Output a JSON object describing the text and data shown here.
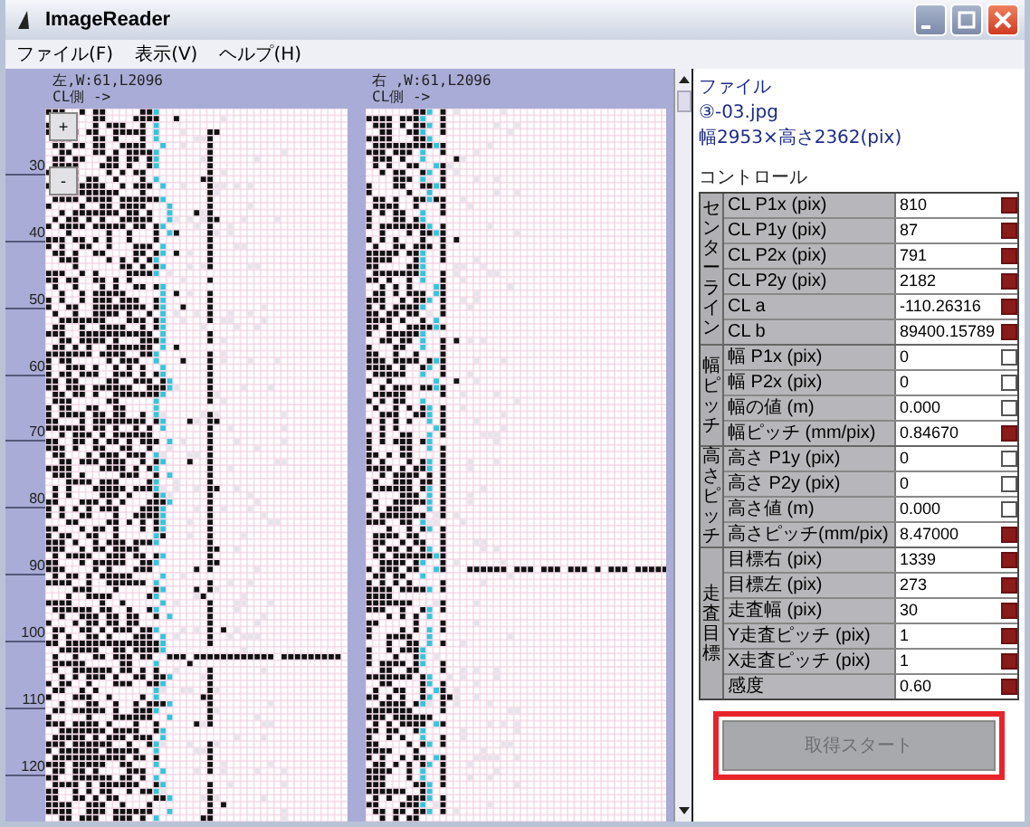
{
  "window": {
    "title": "ImageReader"
  },
  "menu": [
    "ファイル(F)",
    "表示(V)",
    "ヘルプ(H)"
  ],
  "views": [
    {
      "caption_1": "左,W:61,L2096",
      "caption_2": "CL側 ->"
    },
    {
      "caption_1": "右 ,W:61,L2096",
      "caption_2": "CL側 ->"
    }
  ],
  "zoom_buttons": [
    "+",
    "-"
  ],
  "ruler_labels": [
    "30",
    "40",
    "50",
    "60",
    "70",
    "80",
    "90",
    "100",
    "110",
    "120"
  ],
  "info": {
    "heading": "ファイル",
    "file_name": "③-03.jpg",
    "dimensions": "幅2953×高さ2362(pix)"
  },
  "controls": {
    "heading": "コントロール",
    "groups": [
      {
        "label": "センターライン",
        "rows": [
          {
            "label": "CL P1x (pix)",
            "value": "810",
            "set": true
          },
          {
            "label": "CL P1y (pix)",
            "value": "87",
            "set": true
          },
          {
            "label": "CL P2x (pix)",
            "value": "791",
            "set": true
          },
          {
            "label": "CL P2y (pix)",
            "value": "2182",
            "set": true
          },
          {
            "label": "CL a",
            "value": "-110.26316",
            "set": true
          },
          {
            "label": "CL b",
            "value": "89400.15789",
            "set": true
          }
        ]
      },
      {
        "label": "幅ピッチ",
        "rows": [
          {
            "label": "幅 P1x (pix)",
            "value": "0",
            "set": false
          },
          {
            "label": "幅 P2x (pix)",
            "value": "0",
            "set": false
          },
          {
            "label": "幅の値 (m)",
            "value": "0.000",
            "set": false
          },
          {
            "label": "幅ピッチ (mm/pix)",
            "value": "0.84670",
            "set": true
          }
        ]
      },
      {
        "label": "高さピッチ",
        "rows": [
          {
            "label": "高さ P1y (pix)",
            "value": "0",
            "set": false
          },
          {
            "label": "高さ P2y (pix)",
            "value": "0",
            "set": false
          },
          {
            "label": "高さ値 (m)",
            "value": "0.000",
            "set": false
          },
          {
            "label": "高さピッチ(mm/pix)",
            "value": "8.47000",
            "set": true
          }
        ]
      },
      {
        "label": "走査目標",
        "rows": [
          {
            "label": "目標右 (pix)",
            "value": "1339",
            "set": true
          },
          {
            "label": "目標左 (pix)",
            "value": "273",
            "set": true
          },
          {
            "label": "走査幅 (pix)",
            "value": "30",
            "set": true
          },
          {
            "label": "Y走査ピッチ (pix)",
            "value": "1",
            "set": true
          },
          {
            "label": "X走査ピッチ (pix)",
            "value": "1",
            "set": true
          },
          {
            "label": "感度",
            "value": "0.60",
            "set": true
          }
        ]
      }
    ]
  },
  "start_button": {
    "label": "取得スタート",
    "disabled": true,
    "highlighted": true
  }
}
